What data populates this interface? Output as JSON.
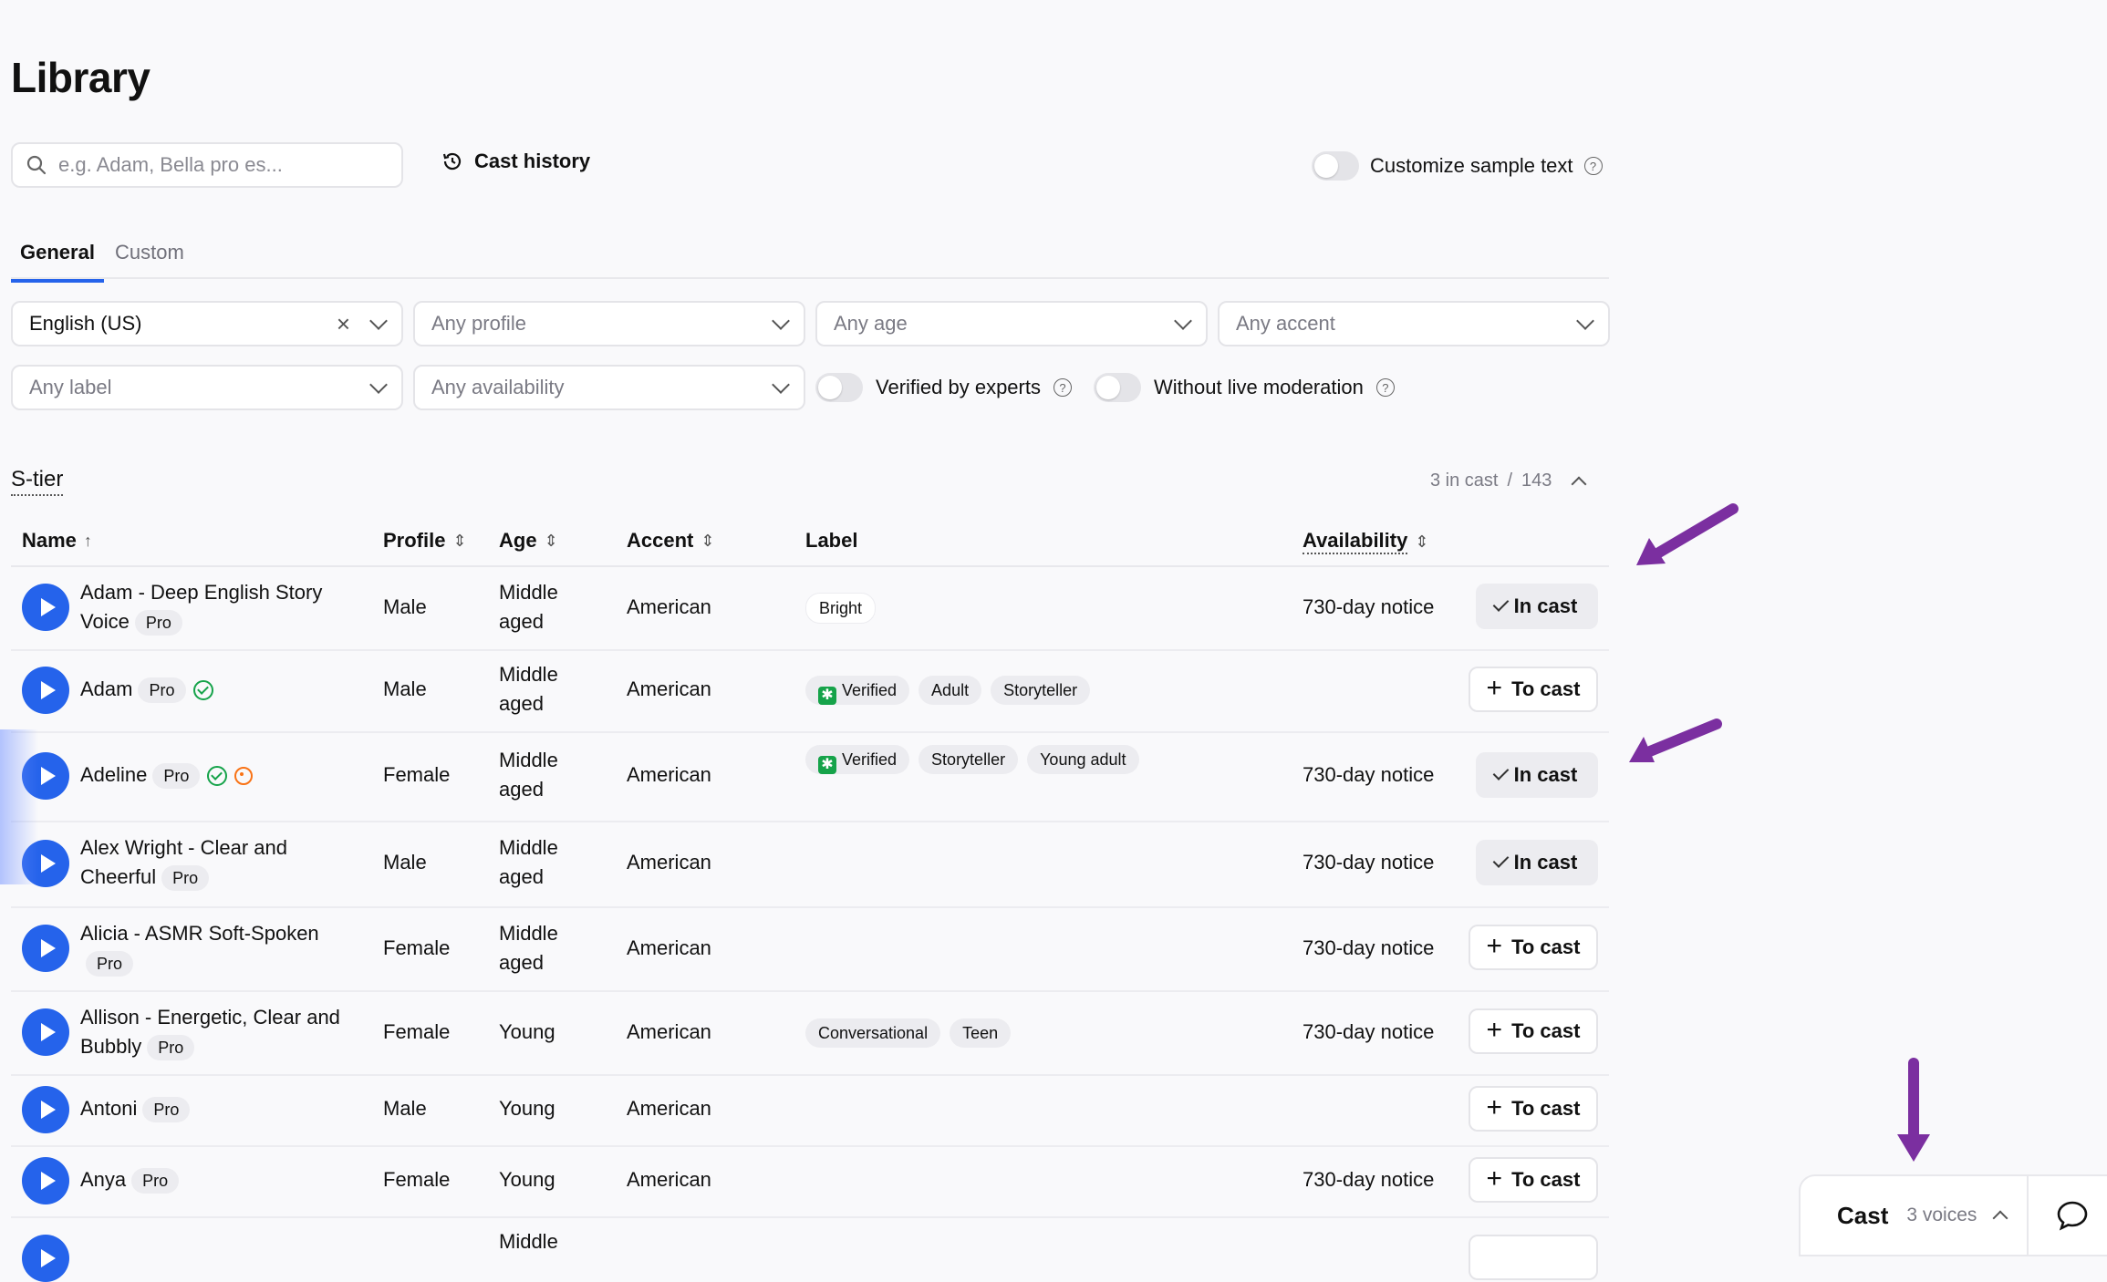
{
  "page": {
    "title": "Library"
  },
  "toolbar": {
    "search_placeholder": "e.g. Adam, Bella pro es...",
    "cast_history_label": "Cast history",
    "customize_label": "Customize sample text"
  },
  "tabs": [
    {
      "label": "General",
      "active": true
    },
    {
      "label": "Custom",
      "active": false
    }
  ],
  "filters": {
    "language": "English (US)",
    "profile": "Any profile",
    "age": "Any age",
    "accent": "Any accent",
    "label": "Any label",
    "availability": "Any availability",
    "verified_label": "Verified by experts",
    "moderation_label": "Without live moderation"
  },
  "section": {
    "title": "S-tier",
    "in_cast": "3 in cast",
    "separator": "/",
    "total": "143"
  },
  "columns": {
    "name": "Name",
    "profile": "Profile",
    "age": "Age",
    "accent": "Accent",
    "label": "Label",
    "availability": "Availability"
  },
  "rows": [
    {
      "name": "Adam - Deep English Story Voice",
      "pro": "Pro",
      "profile": "Male",
      "age": "Middle aged",
      "accent": "American",
      "labels": [
        "Bright"
      ],
      "availability": "730-day notice",
      "action": "In cast"
    },
    {
      "name": "Adam",
      "pro": "Pro",
      "profile": "Male",
      "age": "Middle aged",
      "accent": "American",
      "labels": [
        "Verified",
        "Adult",
        "Storyteller"
      ],
      "availability": "",
      "action": "To cast"
    },
    {
      "name": "Adeline",
      "pro": "Pro",
      "profile": "Female",
      "age": "Middle aged",
      "accent": "American",
      "labels": [
        "Verified",
        "Storyteller",
        "Young adult"
      ],
      "availability": "730-day notice",
      "action": "In cast"
    },
    {
      "name": "Alex Wright - Clear and Cheerful",
      "pro": "Pro",
      "profile": "Male",
      "age": "Middle aged",
      "accent": "American",
      "labels": [],
      "availability": "730-day notice",
      "action": "In cast"
    },
    {
      "name": "Alicia - ASMR Soft-Spoken",
      "pro": "Pro",
      "profile": "Female",
      "age": "Middle aged",
      "accent": "American",
      "labels": [],
      "availability": "730-day notice",
      "action": "To cast"
    },
    {
      "name": "Allison - Energetic, Clear and Bubbly",
      "pro": "Pro",
      "profile": "Female",
      "age": "Young",
      "accent": "American",
      "labels": [
        "Conversational",
        "Teen"
      ],
      "availability": "730-day notice",
      "action": "To cast"
    },
    {
      "name": "Antoni",
      "pro": "Pro",
      "profile": "Male",
      "age": "Young",
      "accent": "American",
      "labels": [],
      "availability": "",
      "action": "To cast"
    },
    {
      "name": "Anya",
      "pro": "Pro",
      "profile": "Female",
      "age": "Young",
      "accent": "American",
      "labels": [],
      "availability": "730-day notice",
      "action": "To cast"
    },
    {
      "name": "",
      "pro": "",
      "profile": "",
      "age": "Middle",
      "accent": "",
      "labels": [],
      "availability": "",
      "action": ""
    }
  ],
  "cast_panel": {
    "label": "Cast",
    "count": "3 voices"
  },
  "colors": {
    "accent": "#2563eb",
    "verified": "#16a34a",
    "live": "#f97316",
    "annotation_arrow": "#7b2fa0"
  },
  "icons": [
    "search-icon",
    "history-icon",
    "help-icon",
    "close-icon",
    "chevron-down-icon",
    "sort-up-icon",
    "sort-icon",
    "play-icon",
    "verified-icon",
    "live-icon",
    "check-icon",
    "plus-icon",
    "chevron-up-icon",
    "chat-icon"
  ]
}
